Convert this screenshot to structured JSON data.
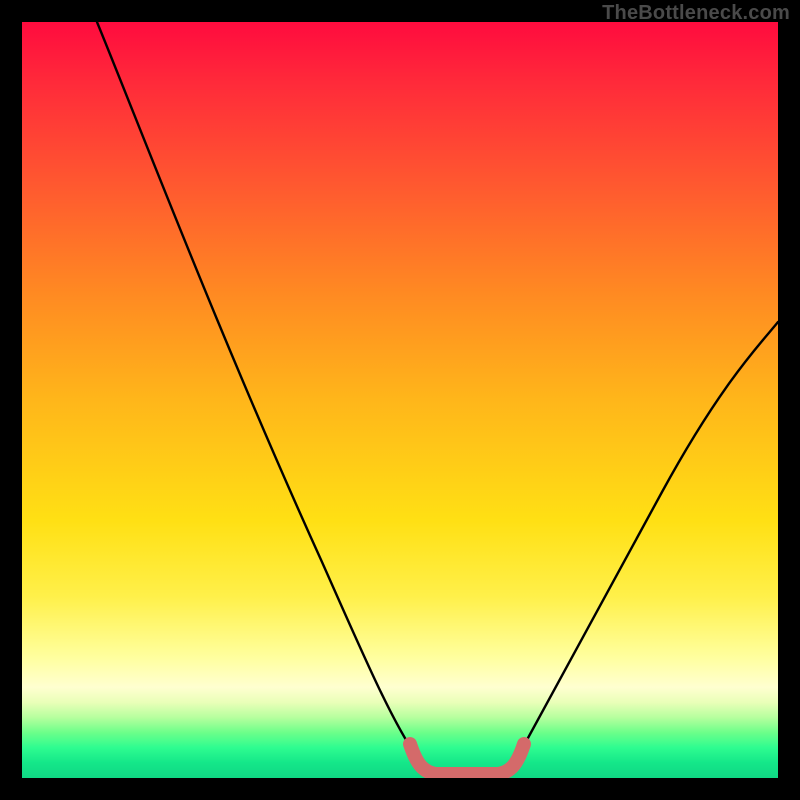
{
  "watermark": "TheBottleneck.com",
  "colors": {
    "frame": "#000000",
    "curve": "#000000",
    "highlight": "#d46a6a",
    "gradient_top": "#ff0b3e",
    "gradient_bottom": "#10d884"
  },
  "chart_data": {
    "type": "line",
    "title": "",
    "xlabel": "",
    "ylabel": "",
    "xlim": [
      0,
      100
    ],
    "ylim": [
      0,
      100
    ],
    "series": [
      {
        "name": "bottleneck-curve",
        "x": [
          10,
          15,
          20,
          25,
          30,
          35,
          40,
          45,
          50,
          53,
          55,
          58,
          60,
          62,
          65,
          70,
          75,
          80,
          85,
          90,
          95,
          100
        ],
        "values": [
          100,
          90,
          80,
          70,
          59,
          48,
          37,
          25,
          12,
          3,
          1,
          1,
          1,
          2,
          6,
          14,
          22,
          30,
          38,
          46,
          53,
          60
        ]
      },
      {
        "name": "optimal-range-highlight",
        "x": [
          51,
          53,
          55,
          58,
          60,
          62,
          64
        ],
        "values": [
          5,
          2,
          1,
          1,
          1,
          2,
          5
        ]
      }
    ],
    "annotations": []
  }
}
